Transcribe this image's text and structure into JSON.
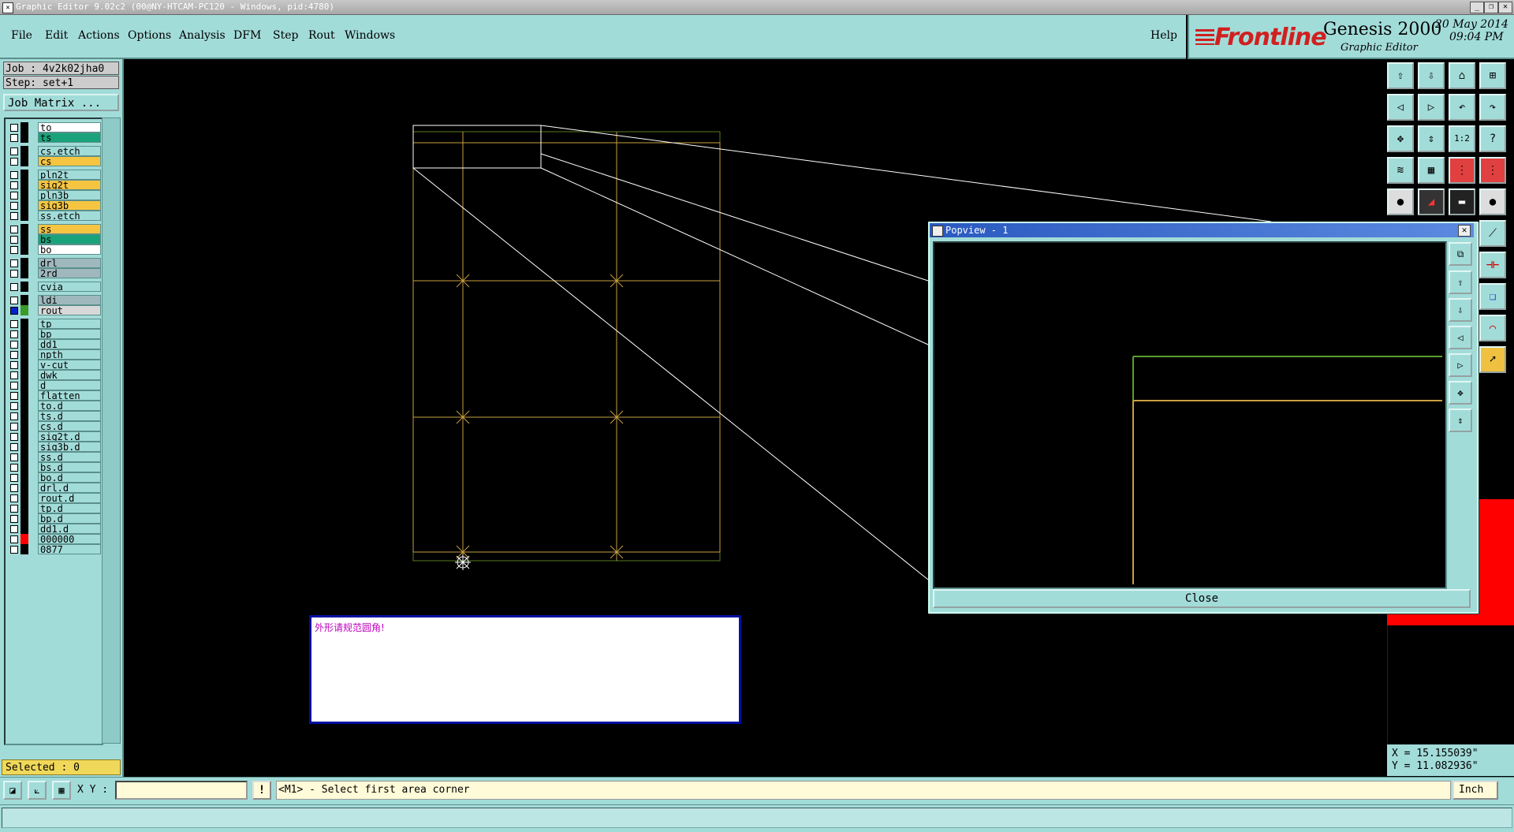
{
  "window": {
    "title": "Graphic Editor 9.02c2 (00@NY-HTCAM-PC120 - Windows, pid:4780)",
    "buttons": [
      "_",
      "❐",
      "✕"
    ]
  },
  "menu": {
    "items": [
      "File",
      "Edit",
      "Actions",
      "Options",
      "Analysis",
      "DFM",
      "Step",
      "Rout",
      "Windows"
    ],
    "help": "Help"
  },
  "brand": {
    "logo": "Frontline",
    "product": "Genesis 2000",
    "subtitle": "Graphic Editor",
    "date": "20 May 2014",
    "time": "09:04 PM"
  },
  "job": {
    "job_label": "Job : 4v2k02jha0",
    "step_label": "Step: set+1",
    "matrix_button": "Job Matrix ..."
  },
  "layers": [
    {
      "name": "to",
      "color": "#ffffff",
      "swatch": "#000000"
    },
    {
      "name": "ts",
      "color": "#1aa37a",
      "swatch": "#000000"
    },
    {
      "name": "cs.etch",
      "color": "#a2dcd9",
      "swatch": "#000000"
    },
    {
      "name": "cs",
      "color": "#f5c542",
      "swatch": "#000000"
    },
    {
      "name": "pln2t",
      "color": "#a2dcd9",
      "swatch": "#000000"
    },
    {
      "name": "sig2t",
      "color": "#f5c542",
      "swatch": "#000000"
    },
    {
      "name": "pln3b",
      "color": "#a2dcd9",
      "swatch": "#000000"
    },
    {
      "name": "sig3b",
      "color": "#f5c542",
      "swatch": "#000000"
    },
    {
      "name": "ss.etch",
      "color": "#a2dcd9",
      "swatch": "#000000"
    },
    {
      "name": "ss",
      "color": "#f5c542",
      "swatch": "#000000"
    },
    {
      "name": "bs",
      "color": "#1aa37a",
      "swatch": "#000000"
    },
    {
      "name": "bo",
      "color": "#ffffff",
      "swatch": "#000000"
    },
    {
      "name": "drl",
      "color": "#9fb8bd",
      "swatch": "#000000"
    },
    {
      "name": "2rd",
      "color": "#9fb8bd",
      "swatch": "#000000"
    },
    {
      "name": "cvia",
      "color": "#a2dcd9",
      "swatch": "#000000"
    },
    {
      "name": "ldi",
      "color": "#9fb8bd",
      "swatch": "#000000"
    },
    {
      "name": "rout",
      "color": "#d8d8d8",
      "swatch": "#3a9a2a"
    },
    {
      "name": "tp",
      "color": "#a2dcd9",
      "swatch": "#000000"
    },
    {
      "name": "bp",
      "color": "#a2dcd9",
      "swatch": "#000000"
    },
    {
      "name": "dd1",
      "color": "#a2dcd9",
      "swatch": "#000000"
    },
    {
      "name": "npth",
      "color": "#a2dcd9",
      "swatch": "#000000"
    },
    {
      "name": "v-cut",
      "color": "#a2dcd9",
      "swatch": "#000000"
    },
    {
      "name": "dwk",
      "color": "#a2dcd9",
      "swatch": "#000000"
    },
    {
      "name": "d",
      "color": "#a2dcd9",
      "swatch": "#000000"
    },
    {
      "name": "flatten",
      "color": "#a2dcd9",
      "swatch": "#000000"
    },
    {
      "name": "to.d",
      "color": "#a2dcd9",
      "swatch": "#000000"
    },
    {
      "name": "ts.d",
      "color": "#a2dcd9",
      "swatch": "#000000"
    },
    {
      "name": "cs.d",
      "color": "#a2dcd9",
      "swatch": "#000000"
    },
    {
      "name": "sig2t.d",
      "color": "#a2dcd9",
      "swatch": "#000000"
    },
    {
      "name": "sig3b.d",
      "color": "#a2dcd9",
      "swatch": "#000000"
    },
    {
      "name": "ss.d",
      "color": "#a2dcd9",
      "swatch": "#000000"
    },
    {
      "name": "bs.d",
      "color": "#a2dcd9",
      "swatch": "#000000"
    },
    {
      "name": "bo.d",
      "color": "#a2dcd9",
      "swatch": "#000000"
    },
    {
      "name": "drl.d",
      "color": "#a2dcd9",
      "swatch": "#000000"
    },
    {
      "name": "rout.d",
      "color": "#a2dcd9",
      "swatch": "#000000"
    },
    {
      "name": "tp.d",
      "color": "#a2dcd9",
      "swatch": "#000000"
    },
    {
      "name": "bp.d",
      "color": "#a2dcd9",
      "swatch": "#000000"
    },
    {
      "name": "dd1.d",
      "color": "#a2dcd9",
      "swatch": "#000000"
    },
    {
      "name": "000000",
      "color": "#a2dcd9",
      "swatch": "#ff0000"
    },
    {
      "name": "0877",
      "color": "#a2dcd9",
      "swatch": "#000000"
    }
  ],
  "selected": "Selected : 0",
  "message": "外形请规范圆角!",
  "popview": {
    "title": "Popview - 1",
    "close_button": "Close"
  },
  "coords": {
    "x": "X = 15.155039\"",
    "y": "Y = 11.082936\""
  },
  "bottom": {
    "xy_label": "X Y :",
    "xy_value": "",
    "prompt": "<M1> - Select first area corner",
    "unit": "Inch"
  },
  "icons": {
    "right_toolbar": [
      "open-icon",
      "save-icon",
      "home-icon",
      "layout-icon",
      "prev-icon",
      "next-icon",
      "undo-icon",
      "redo-icon",
      "fit-icon",
      "zoom-icon",
      "scale-1-2-icon",
      "help-icon",
      "measure-icon",
      "grid-icon",
      "netlist-icon",
      "compare-icon",
      "camera-icon",
      "pen-icon",
      "ruler-icon",
      "dot-icon",
      "connect-icon",
      "film-icon",
      "copy-icon",
      "flash-icon",
      "select-icon"
    ]
  }
}
